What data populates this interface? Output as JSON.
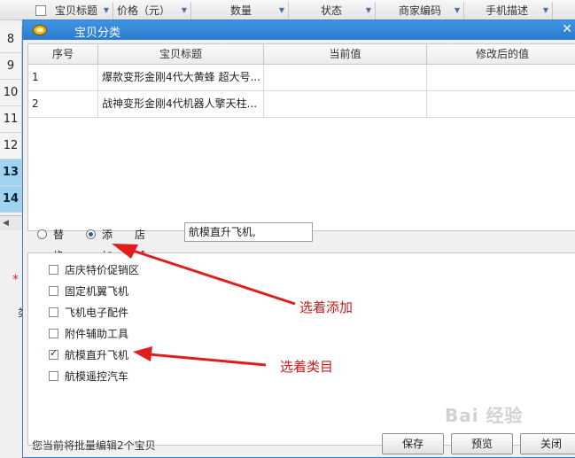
{
  "background": {
    "columns": [
      "宝贝标题",
      "价格（元）",
      "数量",
      "状态",
      "商家编码",
      "手机描述"
    ],
    "row_numbers": [
      "8",
      "9",
      "10",
      "11",
      "12",
      "13",
      "14"
    ],
    "selected_rows": [
      "13",
      "14"
    ],
    "required_mark": "*",
    "label_fragment": "类"
  },
  "dialog": {
    "title": "宝贝分类",
    "table": {
      "headers": [
        "序号",
        "宝贝标题",
        "当前值",
        "修改后的值"
      ],
      "rows": [
        {
          "no": "1",
          "title": "爆款变形金刚4代大黄蜂 超大号...",
          "current": "",
          "new": ""
        },
        {
          "no": "2",
          "title": "战神变形金刚4代机器人擎天柱...",
          "current": "",
          "new": ""
        }
      ]
    },
    "mode": {
      "replace_label": "替换",
      "add_label": "添加",
      "selected": "添加",
      "category_label": "店铺分类",
      "category_value": "航模直升飞机,"
    },
    "categories": [
      {
        "label": "店庆特价促销区",
        "checked": false
      },
      {
        "label": "固定机翼飞机",
        "checked": false
      },
      {
        "label": "飞机电子配件",
        "checked": false
      },
      {
        "label": "附件辅助工具",
        "checked": false
      },
      {
        "label": "航模直升飞机",
        "checked": true
      },
      {
        "label": "航模遥控汽车",
        "checked": false
      }
    ],
    "annotations": {
      "add_note": "选着添加",
      "category_note": "选着类目"
    },
    "footer": {
      "status": "您当前将批量编辑2个宝贝",
      "save": "保存",
      "preview": "预览",
      "close": "关闭"
    }
  },
  "colors": {
    "accent": "#2a7ccc",
    "annotation": "#c91a1a",
    "selected_row": "#9fd3ef"
  },
  "watermark": "Bai 经验"
}
